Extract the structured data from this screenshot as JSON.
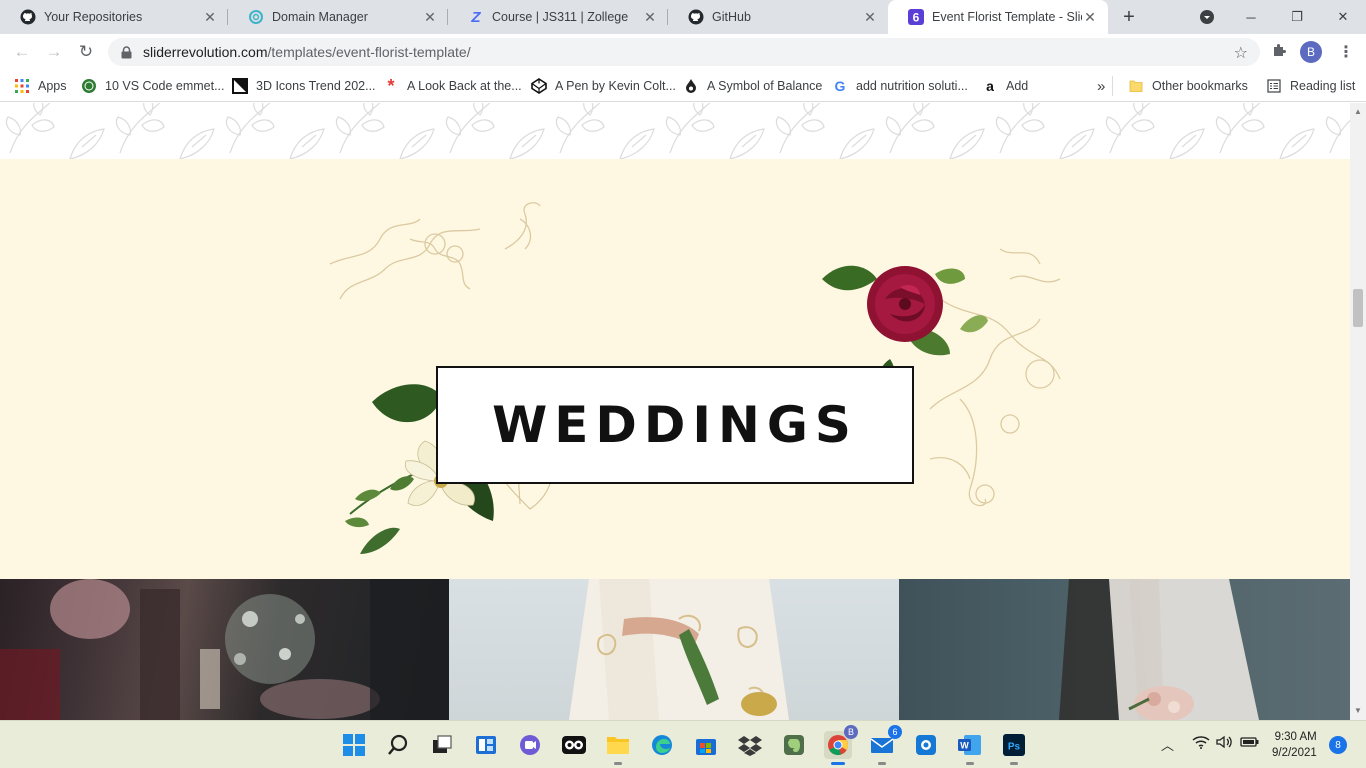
{
  "tabs": [
    {
      "title": "Your Repositories",
      "icon": "github-icon"
    },
    {
      "title": "Domain Manager",
      "icon": "domain-icon"
    },
    {
      "title": "Course | JS311 | Zollege",
      "icon": "zollege-icon"
    },
    {
      "title": "GitHub",
      "icon": "github-icon"
    },
    {
      "title": "Event Florist Template - Slide",
      "icon": "slider-revolution-icon",
      "active": true
    }
  ],
  "toolbar": {
    "url_host": "sliderrevolution.com",
    "url_path": "/templates/event-florist-template/",
    "avatar_letter": "B"
  },
  "bookmarks": {
    "items": [
      {
        "label": "Apps",
        "icon": "apps-grid-icon"
      },
      {
        "label": "10 VS Code emmet...",
        "icon": "globe-icon"
      },
      {
        "label": "3D Icons Trend 202...",
        "icon": "black-square-icon"
      },
      {
        "label": "A Look Back at the...",
        "icon": "asterisk-icon"
      },
      {
        "label": "A Pen by Kevin Colt...",
        "icon": "codepen-icon"
      },
      {
        "label": "A Symbol of Balance",
        "icon": "drop-icon"
      },
      {
        "label": "add nutrition soluti...",
        "icon": "google-icon"
      },
      {
        "label": "Add",
        "icon": "amazon-icon"
      }
    ],
    "overflow": "»",
    "other": "Other bookmarks",
    "reading_list": "Reading list"
  },
  "page": {
    "section_title": "WEDDINGS"
  },
  "taskbar": {
    "time": "9:30 AM",
    "date": "9/2/2021",
    "notifications": "8",
    "chrome_badge": "B",
    "mail_badge": "6"
  },
  "colors": {
    "cream": "#fef8e3",
    "tabstrip": "#dee1e6",
    "rose": "#9b1a3a",
    "leaf": "#2e5a22"
  }
}
